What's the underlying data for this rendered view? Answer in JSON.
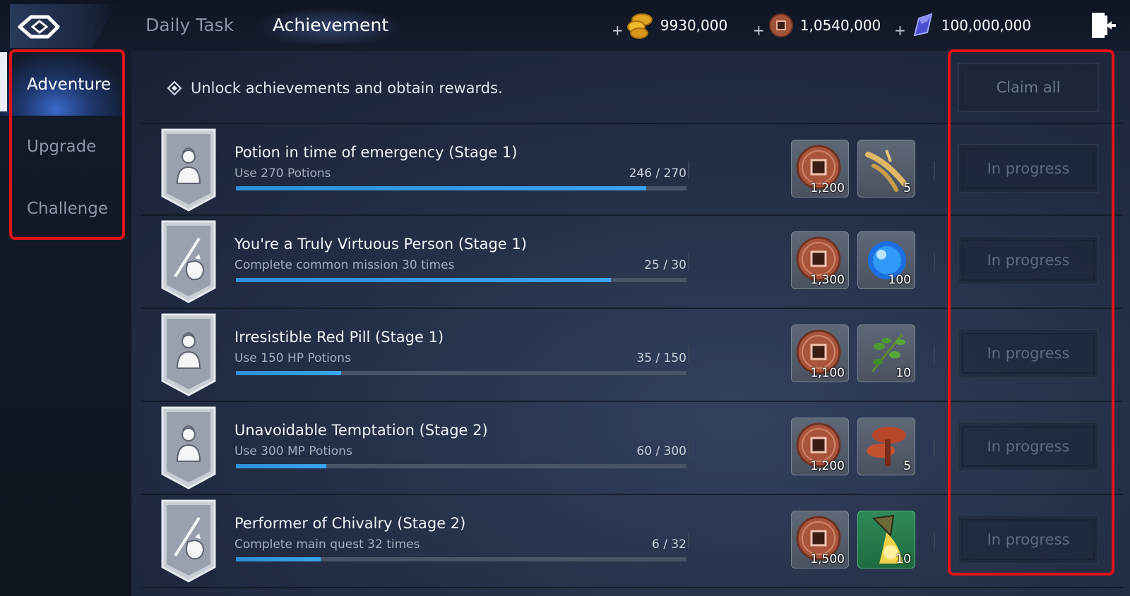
{
  "header": {
    "tabs": {
      "daily": "Daily Task",
      "achievement": "Achievement"
    },
    "currencies": {
      "gold": {
        "plus": "+",
        "amount": "9930,000",
        "icon": "gold-coins-icon"
      },
      "coin": {
        "plus": "+",
        "amount": "1,0540,000",
        "icon": "copper-coin-icon"
      },
      "crystal": {
        "plus": "+",
        "amount": "100,000,000",
        "icon": "crystal-icon"
      }
    }
  },
  "sidebar": {
    "items": [
      {
        "label": "Adventure",
        "active": true
      },
      {
        "label": "Upgrade",
        "active": false
      },
      {
        "label": "Challenge",
        "active": false
      }
    ]
  },
  "main": {
    "info_text": "Unlock achievements and obtain rewards.",
    "claim_all": "Claim all",
    "achievements": [
      {
        "title": "Potion in time of emergency (Stage 1)",
        "desc": "Use 270 Potions",
        "count": "246 / 270",
        "progress": 0.911,
        "badge": "person-icon",
        "rewards": [
          {
            "icon": "copper-coin-icon",
            "qty": "1,200"
          },
          {
            "icon": "ginseng-icon",
            "qty": "5"
          }
        ],
        "status": "In progress"
      },
      {
        "title": "You're a Truly Virtuous Person (Stage 1)",
        "desc": "Complete common mission 30 times",
        "count": "25 / 30",
        "progress": 0.833,
        "badge": "bundle-icon",
        "rewards": [
          {
            "icon": "copper-coin-icon",
            "qty": "1,300"
          },
          {
            "icon": "blue-orb-icon",
            "qty": "100"
          }
        ],
        "status": "In progress"
      },
      {
        "title": "Irresistible Red Pill (Stage 1)",
        "desc": "Use 150 HP Potions",
        "count": "35 / 150",
        "progress": 0.233,
        "badge": "person-icon",
        "rewards": [
          {
            "icon": "copper-coin-icon",
            "qty": "1,100"
          },
          {
            "icon": "herb-icon",
            "qty": "10"
          }
        ],
        "status": "In progress"
      },
      {
        "title": "Unavoidable Temptation (Stage 2)",
        "desc": "Use 300 MP Potions",
        "count": "60 / 300",
        "progress": 0.2,
        "badge": "person-icon",
        "rewards": [
          {
            "icon": "copper-coin-icon",
            "qty": "1,200"
          },
          {
            "icon": "mushroom-icon",
            "qty": "5"
          }
        ],
        "status": "In progress"
      },
      {
        "title": "Performer of Chivalry (Stage 2)",
        "desc": "Complete main quest 32 times",
        "count": "6 / 32",
        "progress": 0.1875,
        "badge": "bundle-icon",
        "rewards": [
          {
            "icon": "copper-coin-icon",
            "qty": "1,500"
          },
          {
            "icon": "gold-dust-scroll-icon",
            "qty": "10"
          }
        ],
        "status": "In progress"
      }
    ]
  },
  "colors": {
    "highlight_box": "#e3131b",
    "progress": "#3aa4ee",
    "accent_active": "#4078e6"
  }
}
